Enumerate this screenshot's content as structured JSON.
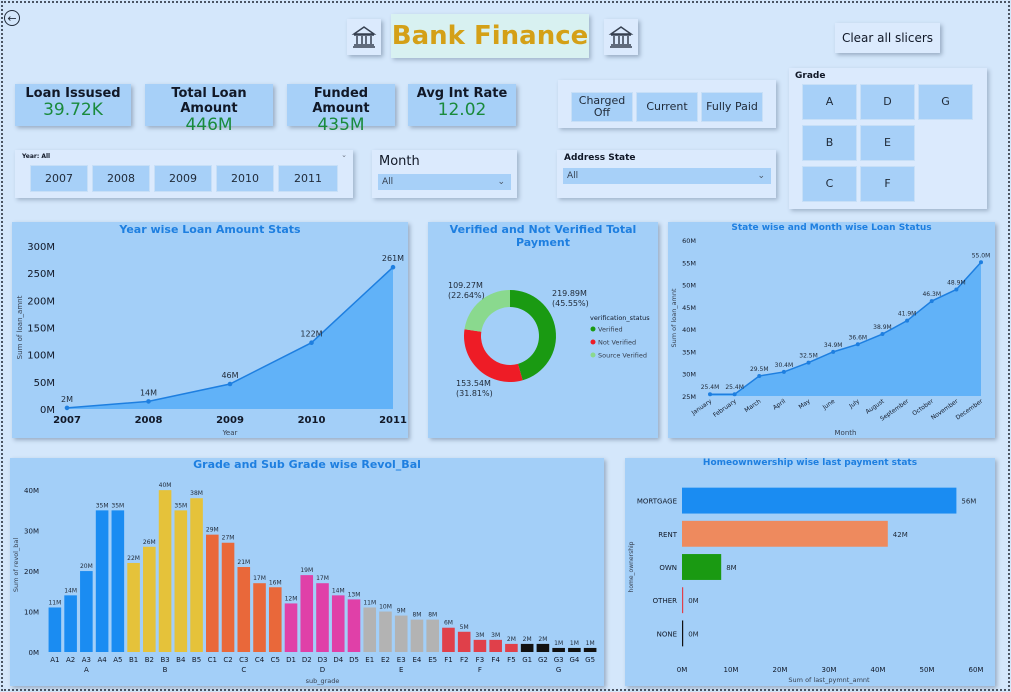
{
  "header": {
    "title": "Bank Finance",
    "clear_button": "Clear all slicers"
  },
  "kpis": [
    {
      "label": "Loan Issused",
      "value": "39.72K"
    },
    {
      "label": "Total Loan Amount",
      "value": "446M"
    },
    {
      "label": "Funded Amount",
      "value": "435M"
    },
    {
      "label": "Avg Int Rate",
      "value": "12.02"
    }
  ],
  "loan_status_slicer": {
    "options": [
      "Charged Off",
      "Current",
      "Fully Paid"
    ]
  },
  "grade_slicer": {
    "label": "Grade",
    "options": [
      "A",
      "D",
      "G",
      "B",
      "E",
      "C",
      "F"
    ]
  },
  "year_slicer": {
    "header": "Year: All",
    "options": [
      "2007",
      "2008",
      "2009",
      "2010",
      "2011"
    ]
  },
  "month_slicer": {
    "label": "Month",
    "value": "All"
  },
  "address_slicer": {
    "label": "Address State",
    "value": "All"
  },
  "colors": {
    "accent": "#1e7fe0",
    "kpi_value": "#1a8a3c",
    "title_gold": "#d4a017",
    "area": "#5aaef7",
    "verified": "#1a9a12",
    "not_verified": "#ee1c26",
    "source_verified": "#8ad98e"
  },
  "chart_data": [
    {
      "id": "year_wise",
      "type": "area",
      "title": "Year wise Loan Amount Stats",
      "xlabel": "Year",
      "ylabel": "Sum of loan_amnt",
      "x": [
        "2007",
        "2008",
        "2009",
        "2010",
        "2011"
      ],
      "values": [
        2,
        14,
        46,
        122,
        261
      ],
      "data_labels": [
        "2M",
        "14M",
        "46M",
        "122M",
        "261M"
      ],
      "yticks": [
        "0M",
        "50M",
        "100M",
        "150M",
        "200M",
        "250M",
        "300M"
      ],
      "ylim": [
        0,
        300
      ]
    },
    {
      "id": "verification",
      "type": "pie",
      "title": "Verified and Not Verified Total Payment",
      "legend_title": "verification_status",
      "series": [
        {
          "name": "Verified",
          "value": 219.89,
          "label1": "219.89M",
          "label2": "(45.55%)"
        },
        {
          "name": "Not Verified",
          "value": 153.54,
          "label1": "153.54M",
          "label2": "(31.81%)"
        },
        {
          "name": "Source Verified",
          "value": 109.27,
          "label1": "109.27M",
          "label2": "(22.64%)"
        }
      ]
    },
    {
      "id": "month_wise",
      "type": "area",
      "title": "State wise and Month wise Loan Status",
      "xlabel": "Month",
      "ylabel": "Sum of loan_amnt",
      "x": [
        "January",
        "February",
        "March",
        "April",
        "May",
        "June",
        "July",
        "August",
        "September",
        "October",
        "November",
        "December"
      ],
      "values": [
        25.4,
        25.4,
        29.5,
        30.4,
        32.5,
        34.9,
        36.6,
        38.9,
        41.9,
        46.3,
        48.9,
        55.0
      ],
      "data_labels": [
        "25.4M",
        "25.4M",
        "29.5M",
        "30.4M",
        "32.5M",
        "34.9M",
        "36.6M",
        "38.9M",
        "41.9M",
        "46.3M",
        "48.9M",
        "55.0M"
      ],
      "yticks": [
        "25M",
        "30M",
        "35M",
        "40M",
        "45M",
        "50M",
        "55M",
        "60M"
      ],
      "ylim": [
        25,
        60
      ]
    },
    {
      "id": "grade_revol",
      "type": "bar",
      "title": "Grade and Sub Grade wise Revol_Bal",
      "xlabel": "sub_grade",
      "ylabel": "Sum of revol_bal",
      "categories": [
        "A1",
        "A2",
        "A3",
        "A4",
        "A5",
        "B1",
        "B2",
        "B3",
        "B4",
        "B5",
        "C1",
        "C2",
        "C3",
        "C4",
        "C5",
        "D1",
        "D2",
        "D3",
        "D4",
        "D5",
        "E1",
        "E2",
        "E3",
        "E4",
        "E5",
        "F1",
        "F2",
        "F3",
        "F4",
        "F5",
        "G1",
        "G2",
        "G3",
        "G4",
        "G5"
      ],
      "groups": [
        "A",
        "B",
        "C",
        "D",
        "E",
        "F",
        "G"
      ],
      "values": [
        11,
        14,
        20,
        35,
        35,
        22,
        26,
        40,
        35,
        38,
        29,
        27,
        21,
        17,
        16,
        12,
        19,
        17,
        14,
        13,
        11,
        10,
        9,
        8,
        8,
        6,
        5,
        3,
        3,
        2,
        2,
        2,
        1,
        1,
        1
      ],
      "data_labels": [
        "11M",
        "14M",
        "20M",
        "35M",
        "35M",
        "22M",
        "26M",
        "40M",
        "35M",
        "38M",
        "29M",
        "27M",
        "21M",
        "17M",
        "16M",
        "12M",
        "19M",
        "17M",
        "14M",
        "13M",
        "11M",
        "10M",
        "9M",
        "8M",
        "8M",
        "6M",
        "5M",
        "3M",
        "3M",
        "2M",
        "2M",
        "2M",
        "1M",
        "1M",
        "1M"
      ],
      "group_colors": {
        "A": "#1a8cf2",
        "B": "#e5c23a",
        "C": "#e9683a",
        "D": "#e040a8",
        "E": "#b3b3b3",
        "F": "#e0404a",
        "G": "#111111"
      },
      "yticks": [
        "0M",
        "10M",
        "20M",
        "30M",
        "40M"
      ],
      "ylim": [
        0,
        43
      ]
    },
    {
      "id": "home_ownership",
      "type": "bar",
      "title": "Homeownwership wise last payment stats",
      "xlabel": "Sum of last_pymnt_amnt",
      "ylabel": "home_ownership",
      "categories": [
        "MORTGAGE",
        "RENT",
        "OWN",
        "OTHER",
        "NONE"
      ],
      "values": [
        56,
        42,
        8,
        0,
        0
      ],
      "data_labels": [
        "56M",
        "42M",
        "8M",
        "0M",
        "0M"
      ],
      "colors": [
        "#1a8cf2",
        "#ee8a5e",
        "#1a9a12",
        "#e0404a",
        "#111111"
      ],
      "xticks": [
        "0M",
        "10M",
        "20M",
        "30M",
        "40M",
        "50M",
        "60M"
      ],
      "xlim": [
        0,
        60
      ]
    }
  ]
}
